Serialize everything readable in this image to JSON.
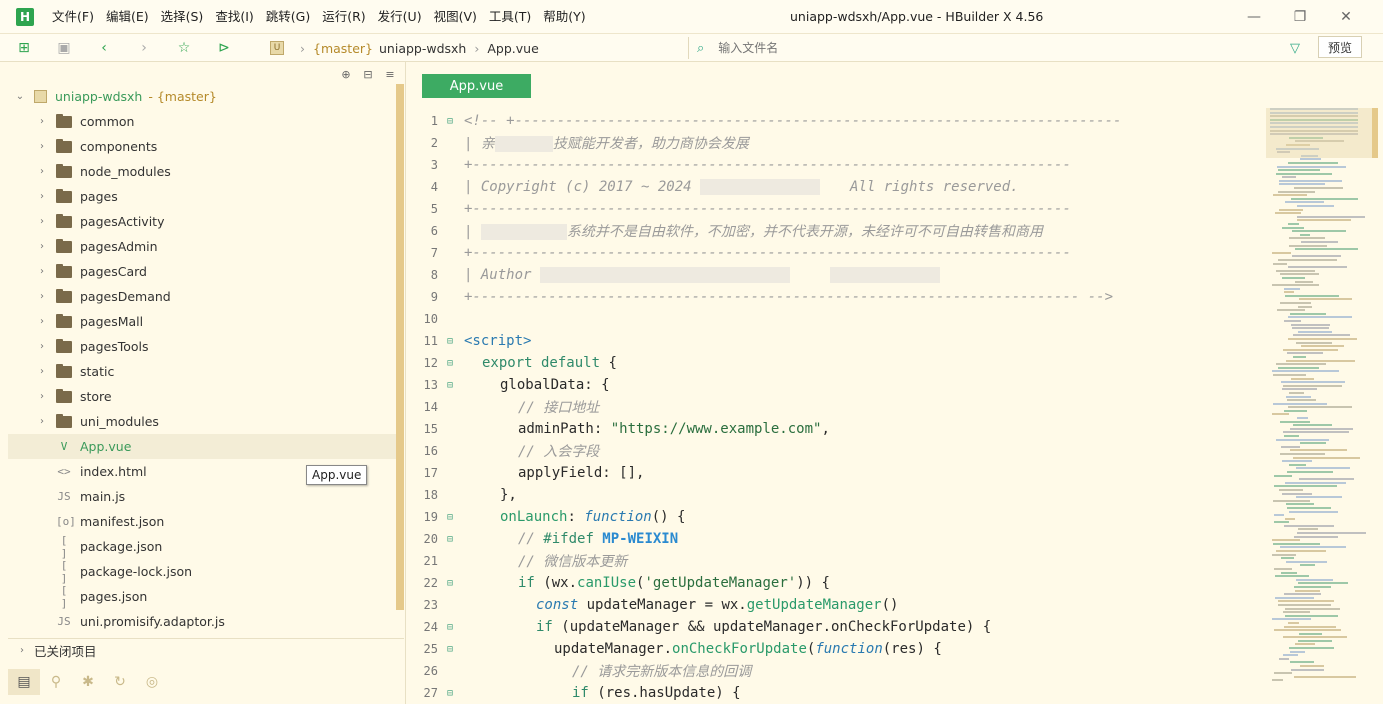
{
  "app": {
    "logo": "H",
    "window_title": "uniapp-wdsxh/App.vue - HBuilder X 4.56",
    "menu": [
      "文件(F)",
      "编辑(E)",
      "选择(S)",
      "查找(I)",
      "跳转(G)",
      "运行(R)",
      "发行(U)",
      "视图(V)",
      "工具(T)",
      "帮助(Y)"
    ],
    "win_controls": {
      "minimize": "—",
      "restore": "❐",
      "close": "✕"
    }
  },
  "toolbar": {
    "icons": [
      "new-file-icon",
      "save-icon",
      "back-icon",
      "forward-icon",
      "star-icon",
      "run-icon"
    ],
    "breadcrumb": {
      "branch": "{master}",
      "project": "uniapp-wdsxh",
      "file": "App.vue"
    },
    "filter_placeholder": "输入文件名",
    "preview_label": "预览"
  },
  "sidebar": {
    "project": "uniapp-wdsxh",
    "project_branch": "- {master}",
    "folders": [
      "common",
      "components",
      "node_modules",
      "pages",
      "pagesActivity",
      "pagesAdmin",
      "pagesCard",
      "pagesDemand",
      "pagesMall",
      "pagesTools",
      "static",
      "store",
      "uni_modules"
    ],
    "files": [
      {
        "name": "App.vue",
        "icon": "V",
        "selected": true
      },
      {
        "name": "index.html",
        "icon": "<>"
      },
      {
        "name": "main.js",
        "icon": "JS"
      },
      {
        "name": "manifest.json",
        "icon": "[o]"
      },
      {
        "name": "package.json",
        "icon": "[ ]"
      },
      {
        "name": "package-lock.json",
        "icon": "[ ]"
      },
      {
        "name": "pages.json",
        "icon": "[ ]"
      },
      {
        "name": "uni.promisify.adaptor.js",
        "icon": "JS"
      }
    ],
    "tooltip": "App.vue",
    "closed_projects": "已关闭项目"
  },
  "editor": {
    "tab": "App.vue",
    "lines": [
      {
        "n": "1",
        "fold": "⊟"
      },
      {
        "n": "2"
      },
      {
        "n": "3"
      },
      {
        "n": "4"
      },
      {
        "n": "5"
      },
      {
        "n": "6"
      },
      {
        "n": "7"
      },
      {
        "n": "8"
      },
      {
        "n": "9"
      },
      {
        "n": "10"
      },
      {
        "n": "11",
        "fold": "⊟"
      },
      {
        "n": "12",
        "fold": "⊟"
      },
      {
        "n": "13",
        "fold": "⊟"
      },
      {
        "n": "14"
      },
      {
        "n": "15"
      },
      {
        "n": "16"
      },
      {
        "n": "17"
      },
      {
        "n": "18"
      },
      {
        "n": "19",
        "fold": "⊟"
      },
      {
        "n": "20",
        "fold": "⊟"
      },
      {
        "n": "21"
      },
      {
        "n": "22",
        "fold": "⊟"
      },
      {
        "n": "23"
      },
      {
        "n": "24",
        "fold": "⊟"
      },
      {
        "n": "25",
        "fold": "⊟"
      },
      {
        "n": "26"
      },
      {
        "n": "27",
        "fold": "⊟"
      }
    ],
    "code": {
      "l1": "<!-- +------------------------------------------------------------------------",
      "l2a": "| 亲",
      "l2b": "技赋能开发者，助力商协会发展",
      "l3": "+-----------------------------------------------------------------------",
      "l4a": "| Copyright (c) 2017 ~ 2024 ",
      "l4b": "All rights reserved.",
      "l5": "+-----------------------------------------------------------------------",
      "l6a": "| ",
      "l6b": "系统并不是自由软件，不加密，并不代表开源，未经许可不可自由转售和商用",
      "l7": "+-----------------------------------------------------------------------",
      "l8a": "| Author ",
      "l9": "+------------------------------------------------------------------------ -->",
      "l11": "<script>",
      "l12a": "export default",
      "l12b": " {",
      "l13": "globalData: {",
      "l14": "// 接口地址",
      "l15a": "adminPath: ",
      "l15b": "\"https://www.example.com\"",
      "l15c": ",",
      "l16": "// 入会字段",
      "l17": "applyField: [],",
      "l18": "},",
      "l19a": "onLaunch",
      "l19b": ": ",
      "l19c": "function",
      "l19d": "() {",
      "l20a": "// ",
      "l20b": "#ifdef",
      "l20c": " MP-WEIXIN",
      "l21": "// 微信版本更新",
      "l22a": "if",
      "l22b": " (wx.",
      "l22c": "canIUse",
      "l22d": "(",
      "l22e": "'getUpdateManager'",
      "l22f": ")) {",
      "l23a": "const",
      "l23b": " updateManager = wx.",
      "l23c": "getUpdateManager",
      "l23d": "()",
      "l24a": "if",
      "l24b": " (updateManager && updateManager.onCheckForUpdate) {",
      "l25a": "updateManager.",
      "l25b": "onCheckForUpdate",
      "l25c": "(",
      "l25d": "function",
      "l25e": "(res) {",
      "l26": "// 请求完新版本信息的回调",
      "l27a": "if",
      "l27b": " (res.hasUpdate) {"
    }
  }
}
